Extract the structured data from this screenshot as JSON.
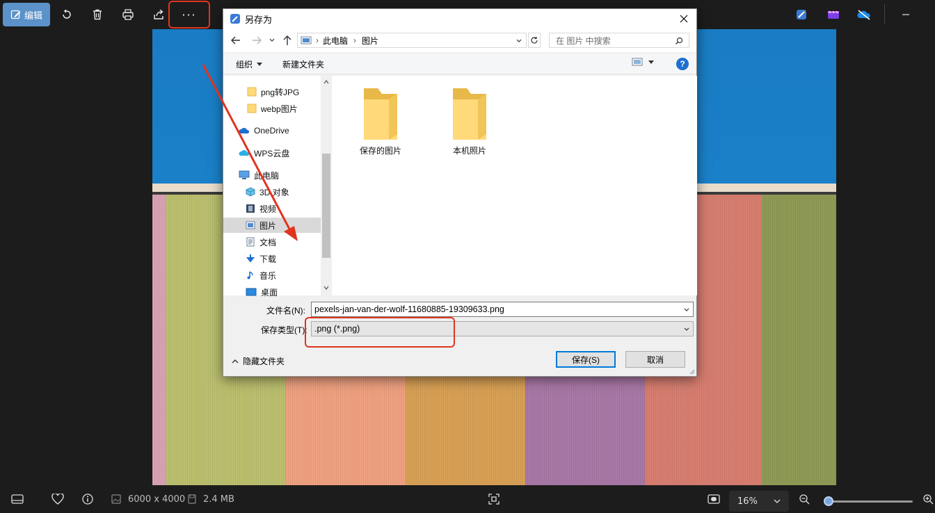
{
  "toolbar": {
    "edit_label": "编辑",
    "more_label": "···",
    "icons": [
      "edit-icon",
      "rotate-icon",
      "delete-icon",
      "print-icon",
      "share-icon",
      "more-icon",
      "ai-edit-icon",
      "video-editor-icon",
      "cloud-off-icon",
      "minimize-icon"
    ]
  },
  "dialog": {
    "title": "另存为",
    "breadcrumb": [
      "此电脑",
      "图片"
    ],
    "search_placeholder": "在 图片 中搜索",
    "organize_label": "组织",
    "new_folder_label": "新建文件夹",
    "help_label": "?",
    "nav_items": [
      {
        "label": "png转JPG",
        "icon": "folder-icon"
      },
      {
        "label": "webp图片",
        "icon": "folder-icon"
      },
      {
        "label": "OneDrive",
        "icon": "onedrive-icon"
      },
      {
        "label": "WPS云盘",
        "icon": "wps-cloud-icon"
      },
      {
        "label": "此电脑",
        "icon": "computer-icon"
      },
      {
        "label": "3D 对象",
        "icon": "3d-objects-icon"
      },
      {
        "label": "视频",
        "icon": "video-icon"
      },
      {
        "label": "图片",
        "icon": "pictures-icon",
        "selected": true
      },
      {
        "label": "文档",
        "icon": "documents-icon"
      },
      {
        "label": "下载",
        "icon": "download-icon"
      },
      {
        "label": "音乐",
        "icon": "music-icon"
      },
      {
        "label": "桌面",
        "icon": "desktop-icon"
      }
    ],
    "folders": [
      {
        "label": "保存的图片"
      },
      {
        "label": "本机照片"
      }
    ],
    "filename_label": "文件名(N):",
    "filename_value": "pexels-jan-van-der-wolf-11680885-19309633.png",
    "filetype_label": "保存类型(T):",
    "filetype_value": ".png (*.png)",
    "hide_folders_label": "隐藏文件夹",
    "save_label": "保存(S)",
    "cancel_label": "取消"
  },
  "status": {
    "dimensions": "6000 x 4000",
    "size": "2.4 MB",
    "zoom": "16%",
    "zoom_level": 0.02
  },
  "colors": {
    "accent": "#5b92c9",
    "annotation": "#e0341e",
    "sky": "#1a7cc4"
  }
}
